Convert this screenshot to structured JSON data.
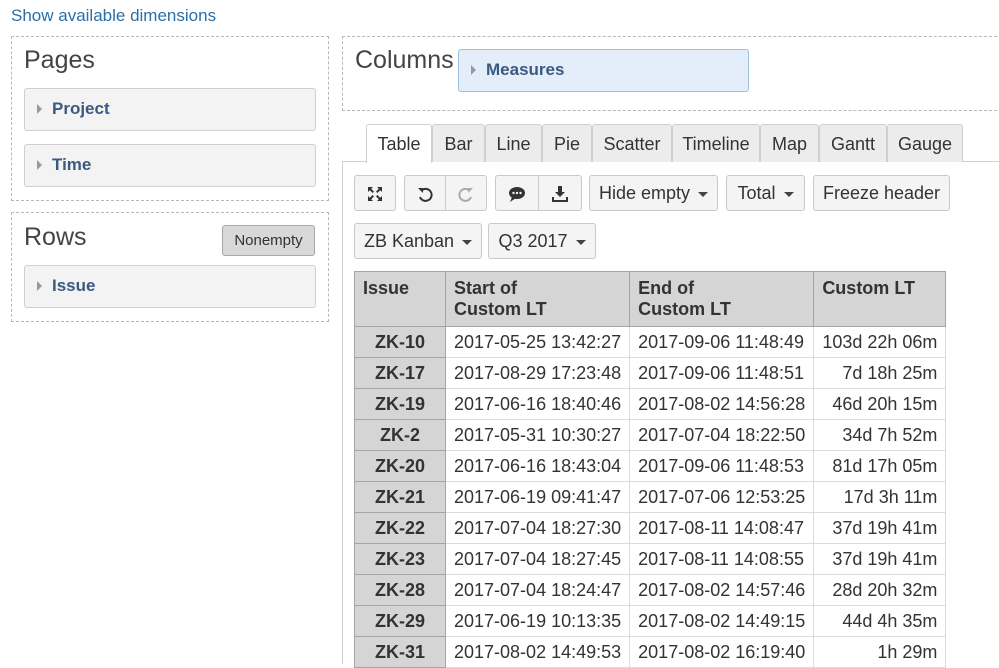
{
  "header": {
    "show_dimensions": "Show available dimensions"
  },
  "pages": {
    "title": "Pages",
    "items": [
      {
        "label": "Project"
      },
      {
        "label": "Time"
      }
    ]
  },
  "rows": {
    "title": "Rows",
    "nonempty": "Nonempty",
    "items": [
      {
        "label": "Issue"
      }
    ]
  },
  "columns": {
    "title": "Columns",
    "items": [
      {
        "label": "Measures"
      }
    ]
  },
  "tabs": [
    "Table",
    "Bar",
    "Line",
    "Pie",
    "Scatter",
    "Timeline",
    "Map",
    "Gantt",
    "Gauge"
  ],
  "active_tab": "Table",
  "toolbar": {
    "hide_empty": "Hide empty",
    "total": "Total",
    "freeze_header": "Freeze header",
    "icons": [
      "expand-icon",
      "undo-icon",
      "redo-icon",
      "comment-icon",
      "download-icon"
    ]
  },
  "filters": {
    "page_project": "ZB Kanban",
    "page_time": "Q3 2017"
  },
  "table": {
    "headers": {
      "issue": "Issue",
      "start_line1": "Start of",
      "start_line2": "Custom LT",
      "end_line1": "End of",
      "end_line2": "Custom LT",
      "custom_lt": "Custom LT"
    },
    "rows": [
      {
        "issue": "ZK-10",
        "start": "2017-05-25 13:42:27",
        "end": "2017-09-06 11:48:49",
        "lt": "103d 22h 06m"
      },
      {
        "issue": "ZK-17",
        "start": "2017-08-29 17:23:48",
        "end": "2017-09-06 11:48:51",
        "lt": "7d 18h 25m"
      },
      {
        "issue": "ZK-19",
        "start": "2017-06-16 18:40:46",
        "end": "2017-08-02 14:56:28",
        "lt": "46d 20h 15m"
      },
      {
        "issue": "ZK-2",
        "start": "2017-05-31 10:30:27",
        "end": "2017-07-04 18:22:50",
        "lt": "34d 7h 52m"
      },
      {
        "issue": "ZK-20",
        "start": "2017-06-16 18:43:04",
        "end": "2017-09-06 11:48:53",
        "lt": "81d 17h 05m"
      },
      {
        "issue": "ZK-21",
        "start": "2017-06-19 09:41:47",
        "end": "2017-07-06 12:53:25",
        "lt": "17d 3h 11m"
      },
      {
        "issue": "ZK-22",
        "start": "2017-07-04 18:27:30",
        "end": "2017-08-11 14:08:47",
        "lt": "37d 19h 41m"
      },
      {
        "issue": "ZK-23",
        "start": "2017-07-04 18:27:45",
        "end": "2017-08-11 14:08:55",
        "lt": "37d 19h 41m"
      },
      {
        "issue": "ZK-28",
        "start": "2017-07-04 18:24:47",
        "end": "2017-08-02 14:57:46",
        "lt": "28d 20h 32m"
      },
      {
        "issue": "ZK-29",
        "start": "2017-06-19 10:13:35",
        "end": "2017-08-02 14:49:15",
        "lt": "44d 4h 35m"
      },
      {
        "issue": "ZK-31",
        "start": "2017-08-02 14:49:53",
        "end": "2017-08-02 16:19:40",
        "lt": "1h 29m"
      }
    ]
  },
  "colors": {
    "link": "#2a6fa8",
    "dimension_text": "#3a5a80",
    "header_bg": "#d5d5d5",
    "measures_bg": "#e3eefa"
  }
}
